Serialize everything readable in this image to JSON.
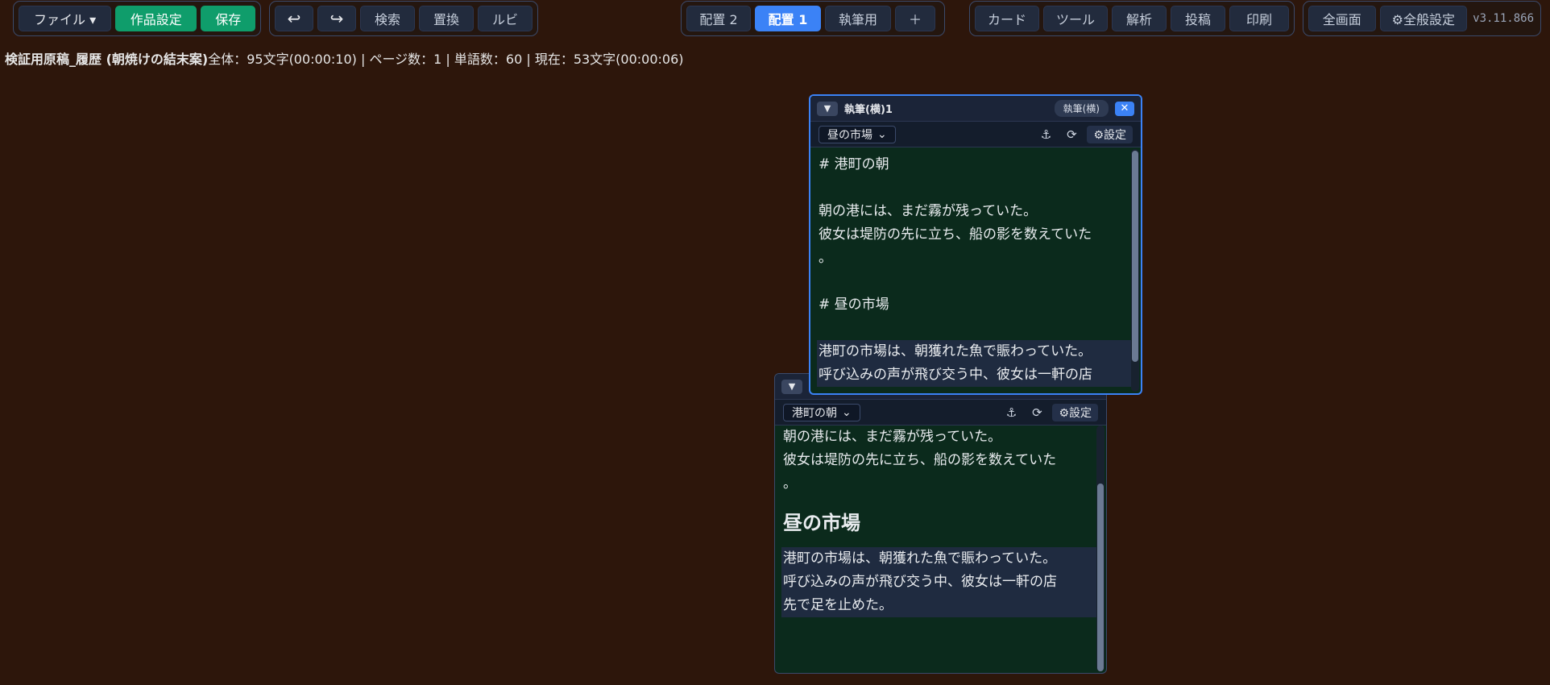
{
  "toolbar": {
    "file": "ファイル ▾",
    "work_settings": "作品設定",
    "save": "保存",
    "undo": "↩",
    "redo": "↪",
    "search": "検索",
    "replace": "置換",
    "ruby": "ルビ",
    "layout2": "配置 2",
    "layout1": "配置 1",
    "writing": "執筆用",
    "add": "＋",
    "card": "カード",
    "tools": "ツール",
    "analysis": "解析",
    "post": "投稿",
    "print": "印刷",
    "fullscreen": "全画面",
    "general_settings": "⚙全般設定",
    "version": "v3.11.866"
  },
  "status": {
    "title": "検証用原稿_履歴 (朝焼けの結末案)",
    "info": "全体：95文字(00:00:10) | ページ数：1 | 単語数：60 | 現在：53文字(00:00:06)"
  },
  "editor_panel": {
    "collapse": "▼",
    "title": "執筆(横)1",
    "badge": "執筆(横)",
    "close": "✕",
    "section_select": "昼の市場",
    "anchor": "⚓",
    "refresh": "⟳",
    "settings": "⚙設定",
    "lines": [
      "# 港町の朝",
      "",
      "朝の港には、まだ霧が残っていた。",
      "彼女は堤防の先に立ち、船の影を数えていた",
      "。",
      "",
      "# 昼の市場",
      "",
      "港町の市場は、朝獲れた魚で賑わっていた。",
      "呼び込みの声が飛び交う中、彼女は一軒の店"
    ]
  },
  "preview_panel": {
    "collapse": "▼",
    "section_select": "港町の朝",
    "anchor": "⚓",
    "refresh": "⟳",
    "settings": "⚙設定",
    "para1": [
      "朝の港には、まだ霧が残っていた。",
      "彼女は堤防の先に立ち、船の影を数えていた",
      "。"
    ],
    "heading": "昼の市場",
    "para2": [
      "港町の市場は、朝獲れた魚で賑わっていた。",
      "呼び込みの声が飛び交う中、彼女は一軒の店",
      "先で足を止めた。"
    ]
  }
}
